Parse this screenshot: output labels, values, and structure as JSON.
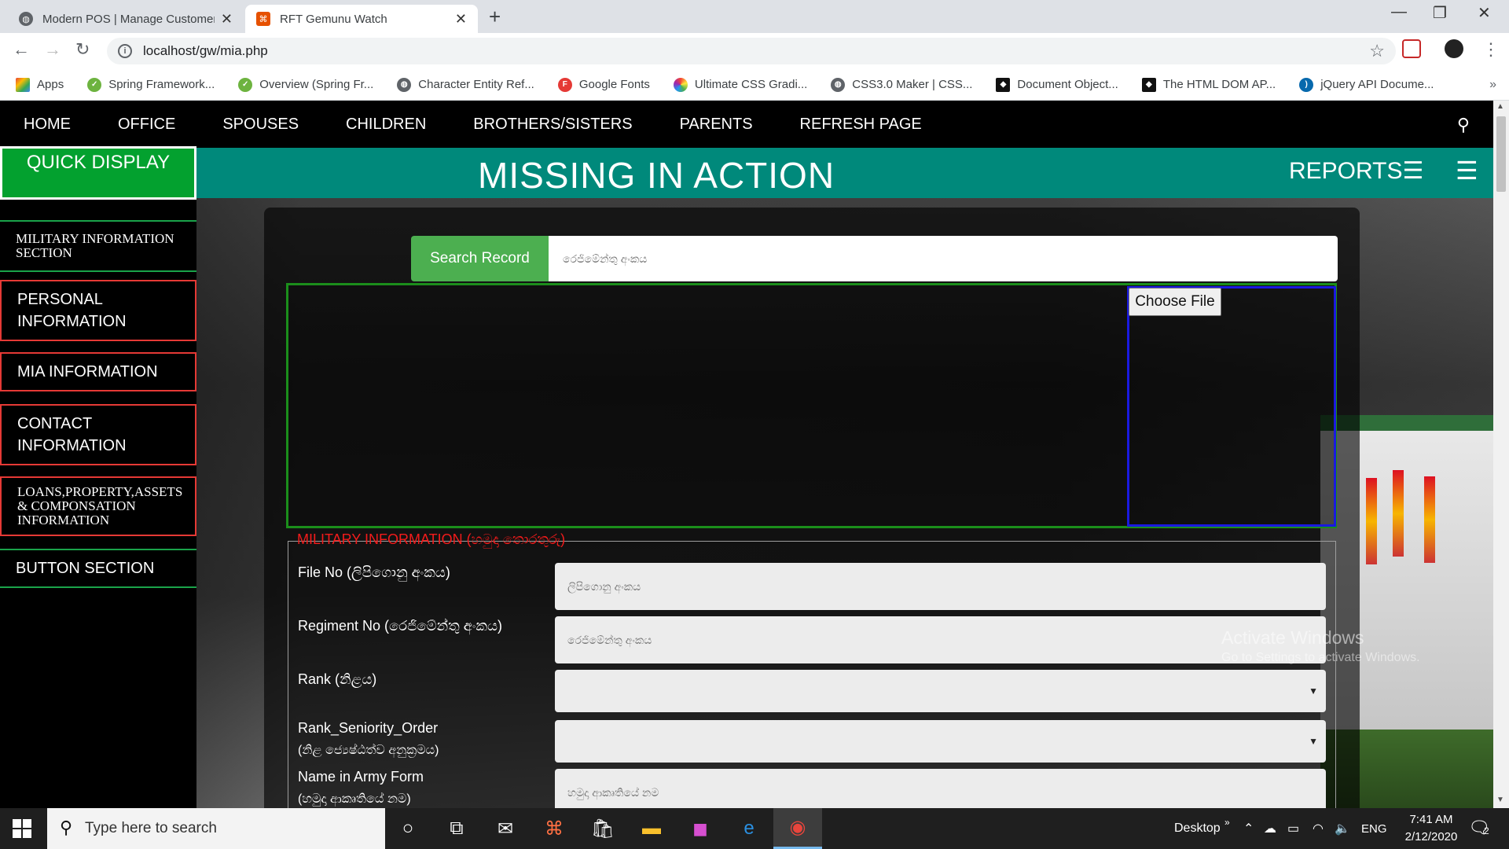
{
  "browser": {
    "tabs": [
      {
        "title": "Modern POS | Manage Customer",
        "active": false,
        "favicon": "globe-icon"
      },
      {
        "title": "RFT Gemunu Watch",
        "active": true,
        "favicon": "html5-icon"
      }
    ],
    "new_tab": "+",
    "url": "localhost/gw/mia.php",
    "bookmarks": [
      {
        "label": "Apps",
        "icon": "apps-grid-icon"
      },
      {
        "label": "Spring Framework...",
        "icon": "spring-icon"
      },
      {
        "label": "Overview (Spring Fr...",
        "icon": "spring-icon"
      },
      {
        "label": "Character Entity Ref...",
        "icon": "globe-icon"
      },
      {
        "label": "Google Fonts",
        "icon": "google-fonts-icon"
      },
      {
        "label": "Ultimate CSS Gradi...",
        "icon": "gradient-icon"
      },
      {
        "label": "CSS3.0 Maker | CSS...",
        "icon": "globe-icon"
      },
      {
        "label": "Document Object...",
        "icon": "mdn-icon"
      },
      {
        "label": "The HTML DOM AP...",
        "icon": "w3-icon"
      },
      {
        "label": "jQuery API Docume...",
        "icon": "jquery-icon"
      }
    ],
    "bookmarks_more": "»"
  },
  "nav": {
    "items": [
      "HOME",
      "OFFICE",
      "SPOUSES",
      "CHILDREN",
      "BROTHERS/SISTERS",
      "PARENTS",
      "REFRESH PAGE"
    ]
  },
  "banner": {
    "title": "MISSING IN ACTION",
    "reports": "REPORTS☰",
    "quick_display": "QUICK DISPLAY"
  },
  "sidebar": {
    "items": [
      {
        "label": "MILITARY INFORMATION SECTION"
      },
      {
        "label": "PERSONAL INFORMATION"
      },
      {
        "label": "MIA INFORMATION"
      },
      {
        "label": "CONTACT INFORMATION"
      },
      {
        "label": "LOANS,PROPERTY,ASSETS & COMPONSATION INFORMATION"
      },
      {
        "label": "BUTTON SECTION"
      }
    ]
  },
  "search": {
    "button": "Search Record",
    "placeholder": "රෙජිමේන්තු අංකය"
  },
  "upload": {
    "button": "Choose File"
  },
  "military": {
    "legend": "MILITARY INFORMATION (හමුදා තොරතුරු)",
    "fields": [
      {
        "label": "File No (ලිපිගොනු අංකය)",
        "placeholder": "ලිපිගොනු අංකය"
      },
      {
        "label": "Regiment No (රෙජිමේන්තු අංකය)",
        "placeholder": "රෙජිමේන්තු අංකය"
      },
      {
        "label": "Rank (නිළය)",
        "placeholder": ""
      },
      {
        "label": "Rank_Seniority_Order",
        "label2": "(නිළ ජ්‍යෙෂ්ඨත්ව අනුක්‍රමය)",
        "placeholder": ""
      },
      {
        "label": "Name in Army Form",
        "label2": "(හමුදා ආකෘතියේ නම)",
        "placeholder": "හමුදා ආකෘතියේ නම"
      }
    ]
  },
  "watermark": {
    "line1": "Activate Windows",
    "line2": "Go to Settings to activate Windows."
  },
  "taskbar": {
    "search_placeholder": "Type here to search",
    "desktop": "Desktop",
    "language": "ENG",
    "time": "7:41 AM",
    "date": "2/12/2020",
    "notifications": "2"
  }
}
